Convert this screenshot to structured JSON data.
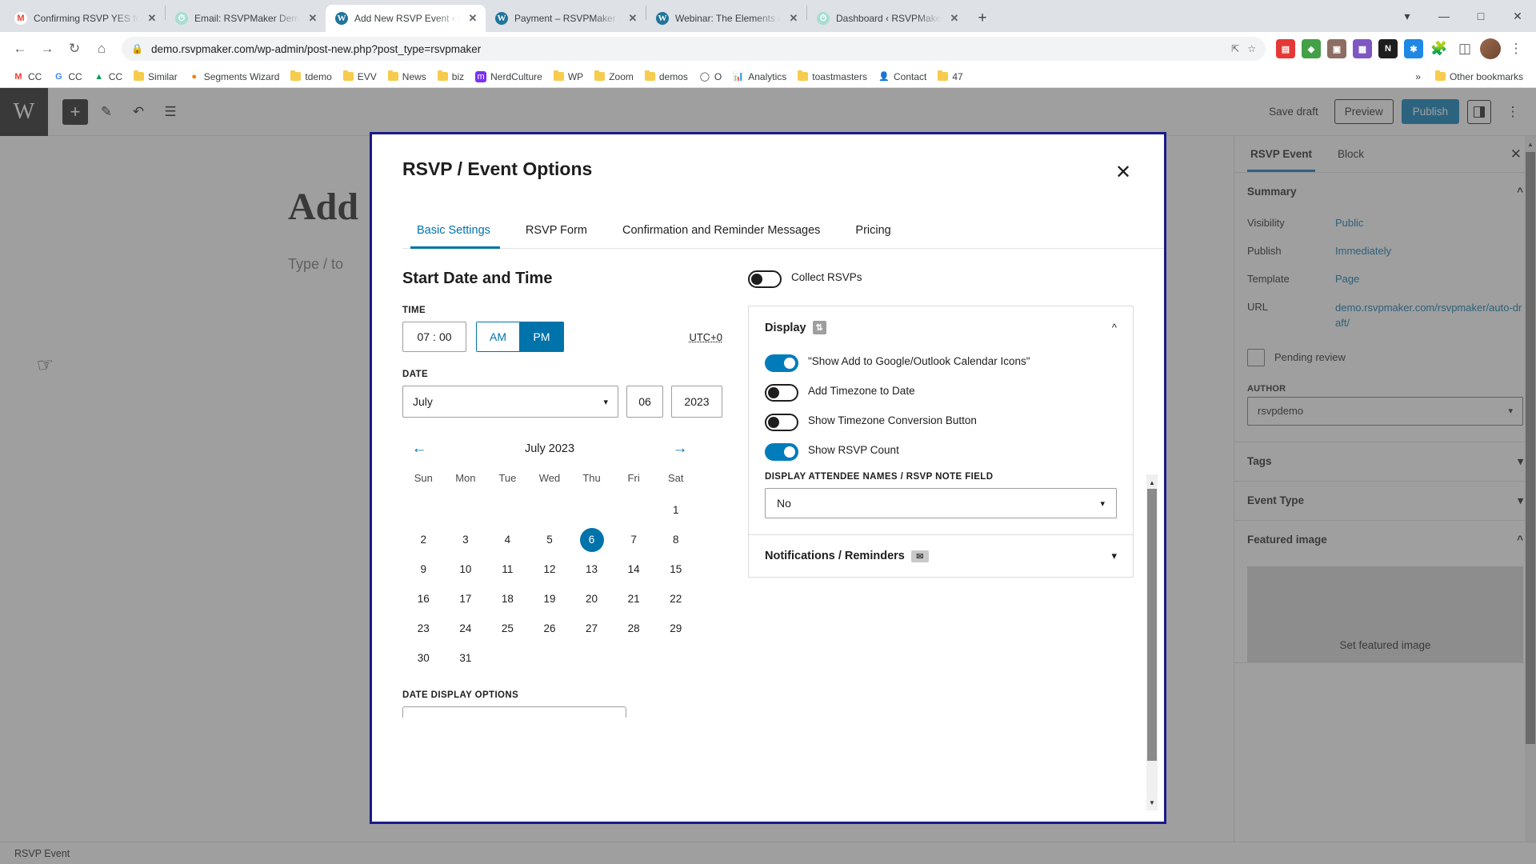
{
  "browser": {
    "tabs": [
      {
        "title": "Confirming RSVP YES for RS",
        "favicon": "gmail-icon",
        "active": false
      },
      {
        "title": "Email: RSVPMaker Demo wi",
        "favicon": "clock-icon",
        "active": false
      },
      {
        "title": "Add New RSVP Event ‹ RSVP",
        "favicon": "wordpress-icon",
        "active": true
      },
      {
        "title": "Payment – RSVPMaker Dem",
        "favicon": "wordpress-icon",
        "active": false
      },
      {
        "title": "Webinar: The Elements of C",
        "favicon": "wordpress-icon",
        "active": false
      },
      {
        "title": "Dashboard ‹ RSVPMaker Ev",
        "favicon": "clock-icon",
        "active": false
      }
    ],
    "new_tab_label": "+",
    "window_controls": {
      "minimize": "—",
      "maximize": "□",
      "close": "✕"
    },
    "toolbar": {
      "back": "←",
      "forward": "→",
      "reload": "↻",
      "home": "⌂",
      "lock_icon": "lock-icon",
      "url": "demo.rsvpmaker.com/wp-admin/post-new.php?post_type=rsvpmaker",
      "share": "share-icon",
      "bookmark_star": "☆",
      "extensions": "puzzle-icon",
      "sidepanel": "sidepanel-icon",
      "menu": "⋮"
    },
    "bookmarks": [
      {
        "label": "CC",
        "icon": "gmail-icon"
      },
      {
        "label": "CC",
        "icon": "google-icon"
      },
      {
        "label": "CC",
        "icon": "drive-icon"
      },
      {
        "label": "Similar",
        "icon": "folder-icon"
      },
      {
        "label": "Segments Wizard",
        "icon": "segments-icon"
      },
      {
        "label": "tdemo",
        "icon": "folder-icon"
      },
      {
        "label": "EVV",
        "icon": "folder-icon"
      },
      {
        "label": "News",
        "icon": "folder-icon"
      },
      {
        "label": "biz",
        "icon": "folder-icon"
      },
      {
        "label": "NerdCulture",
        "icon": "nerdculture-icon"
      },
      {
        "label": "WP",
        "icon": "folder-icon"
      },
      {
        "label": "Zoom",
        "icon": "folder-icon"
      },
      {
        "label": "demos",
        "icon": "folder-icon"
      },
      {
        "label": "O",
        "icon": "opera-icon"
      },
      {
        "label": "Analytics",
        "icon": "analytics-icon"
      },
      {
        "label": "toastmasters",
        "icon": "folder-icon"
      },
      {
        "label": "Contact",
        "icon": "contact-icon"
      },
      {
        "label": "47",
        "icon": "folder-icon"
      }
    ],
    "bookmarks_overflow": "»",
    "other_bookmarks": "Other bookmarks"
  },
  "editor": {
    "logo": "W",
    "add_block": "+",
    "tools": [
      "pencil-icon",
      "undo-icon",
      "list-view-icon"
    ],
    "save_draft": "Save draft",
    "preview": "Preview",
    "publish": "Publish",
    "settings_icon": "settings-sidebar-icon",
    "more_menu": "⋮",
    "canvas_title": "Add",
    "canvas_placeholder": "Type / to",
    "footer_status": "RSVP Event"
  },
  "sidebar": {
    "tabs": [
      {
        "label": "RSVP Event",
        "active": true
      },
      {
        "label": "Block",
        "active": false
      }
    ],
    "close_icon": "close-icon",
    "summary": {
      "heading": "Summary",
      "rows": [
        {
          "key": "Visibility",
          "value": "Public"
        },
        {
          "key": "Publish",
          "value": "Immediately"
        },
        {
          "key": "Template",
          "value": "Page"
        },
        {
          "key": "URL",
          "value": "demo.rsvpmaker.com/rsvpmaker/auto-draft/"
        }
      ],
      "pending_review": "Pending review",
      "author_label": "AUTHOR",
      "author_value": "rsvpdemo"
    },
    "panels": [
      {
        "label": "Tags",
        "expanded": false
      },
      {
        "label": "Event Type",
        "expanded": false
      },
      {
        "label": "Featured image",
        "expanded": true
      }
    ],
    "featured_image_cta": "Set featured image"
  },
  "modal": {
    "title": "RSVP / Event Options",
    "close_icon": "close-icon",
    "tabs": [
      {
        "label": "Basic Settings",
        "active": true
      },
      {
        "label": "RSVP Form",
        "active": false
      },
      {
        "label": "Confirmation and Reminder Messages",
        "active": false
      },
      {
        "label": "Pricing",
        "active": false
      }
    ],
    "start_date": {
      "heading": "Start Date and Time",
      "time_label": "TIME",
      "hour": "07",
      "separator": ":",
      "minute": "00",
      "am_label": "AM",
      "pm_label": "PM",
      "meridiem_selected": "PM",
      "timezone": "UTC+0",
      "date_label": "DATE",
      "month": "July",
      "day": "06",
      "year": "2023"
    },
    "calendar": {
      "prev_icon": "arrow-left-icon",
      "next_icon": "arrow-right-icon",
      "month_year": "July 2023",
      "day_names": [
        "Sun",
        "Mon",
        "Tue",
        "Wed",
        "Thu",
        "Fri",
        "Sat"
      ],
      "lead_blanks": 6,
      "days": [
        1,
        2,
        3,
        4,
        5,
        6,
        7,
        8,
        9,
        10,
        11,
        12,
        13,
        14,
        15,
        16,
        17,
        18,
        19,
        20,
        21,
        22,
        23,
        24,
        25,
        26,
        27,
        28,
        29,
        30,
        31
      ],
      "selected_day": 6
    },
    "date_display_options_label": "DATE DISPLAY OPTIONS",
    "collect_rsvps": {
      "label": "Collect RSVPs",
      "on": false
    },
    "display_panel": {
      "heading": "Display",
      "heading_icon": "sort-icon",
      "chevron": "˄",
      "toggles": [
        {
          "label": "\"Show Add to Google/Outlook Calendar Icons\"",
          "on": true
        },
        {
          "label": "Add Timezone to Date",
          "on": false
        },
        {
          "label": "Show Timezone Conversion Button",
          "on": false
        },
        {
          "label": "Show RSVP Count",
          "on": true
        }
      ],
      "attendee_field_label": "DISPLAY ATTENDEE NAMES / RSVP NOTE FIELD",
      "attendee_field_value": "No"
    },
    "notifications_panel": {
      "heading": "Notifications / Reminders",
      "heading_icon": "mail-icon",
      "chevron": "˅"
    }
  },
  "colors": {
    "accent": "#0073aa",
    "publish": "#007cba",
    "modal_border": "#1a1a8c",
    "link": "#0073aa"
  }
}
